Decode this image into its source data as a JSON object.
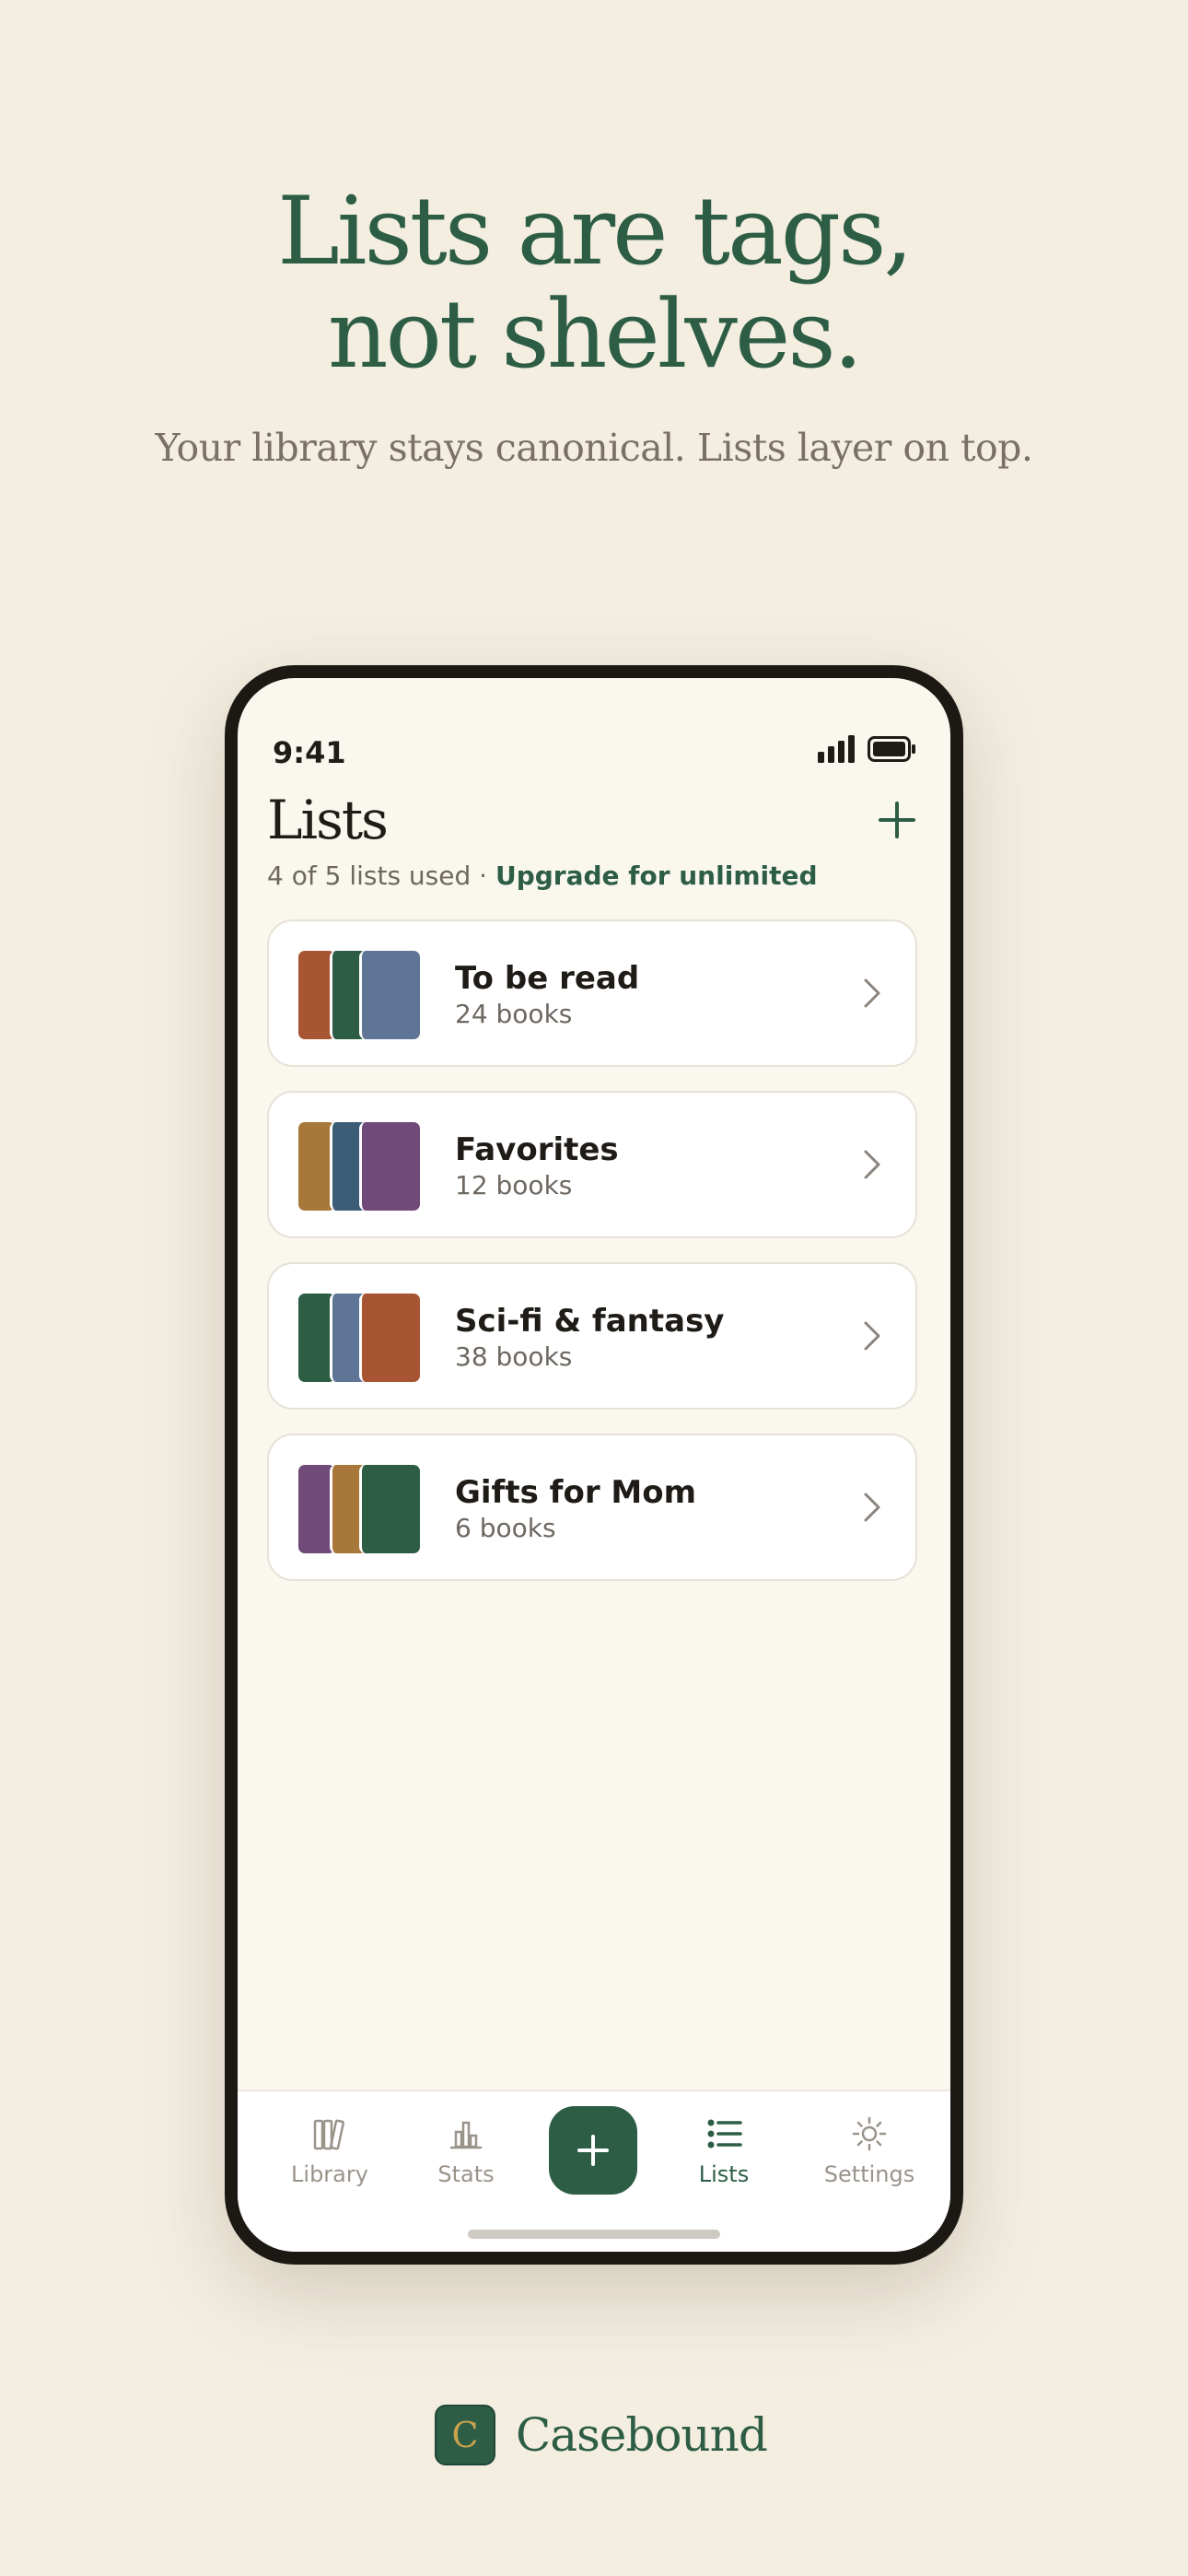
{
  "headline": {
    "line1": "Lists are tags,",
    "line2": "not shelves.",
    "subtitle": "Your library stays canonical. Lists layer on top."
  },
  "status_bar": {
    "time": "9:41",
    "icons": [
      "signal-icon",
      "battery-icon"
    ]
  },
  "screen": {
    "title": "Lists",
    "usage_text": "4 of 5 lists used · ",
    "upgrade_link": "Upgrade for unlimited",
    "lists": [
      {
        "name": "To be read",
        "count": "24 books",
        "cover_colors": [
          "#a85533",
          "#2d5e45",
          "#5e7596"
        ]
      },
      {
        "name": "Favorites",
        "count": "12 books",
        "cover_colors": [
          "#a8783a",
          "#3c5d78",
          "#704a78"
        ]
      },
      {
        "name": "Sci-fi & fantasy",
        "count": "38 books",
        "cover_colors": [
          "#2d5e45",
          "#5e7596",
          "#a85533"
        ]
      },
      {
        "name": "Gifts for Mom",
        "count": "6 books",
        "cover_colors": [
          "#704a78",
          "#a8783a",
          "#2d5e45"
        ]
      }
    ]
  },
  "tab_bar": {
    "tabs": [
      {
        "label": "Library",
        "icon": "library-icon"
      },
      {
        "label": "Stats",
        "icon": "stats-icon"
      },
      {
        "label": "Lists",
        "icon": "lists-icon",
        "active": true
      },
      {
        "label": "Settings",
        "icon": "settings-icon"
      }
    ],
    "fab_icon": "plus-icon"
  },
  "brand": {
    "logo_letter": "C",
    "name": "Casebound"
  },
  "colors": {
    "accent": "#2d5e45",
    "background": "#f4eee1",
    "screen_background": "#faf7ef",
    "muted_text": "#6e6861"
  }
}
